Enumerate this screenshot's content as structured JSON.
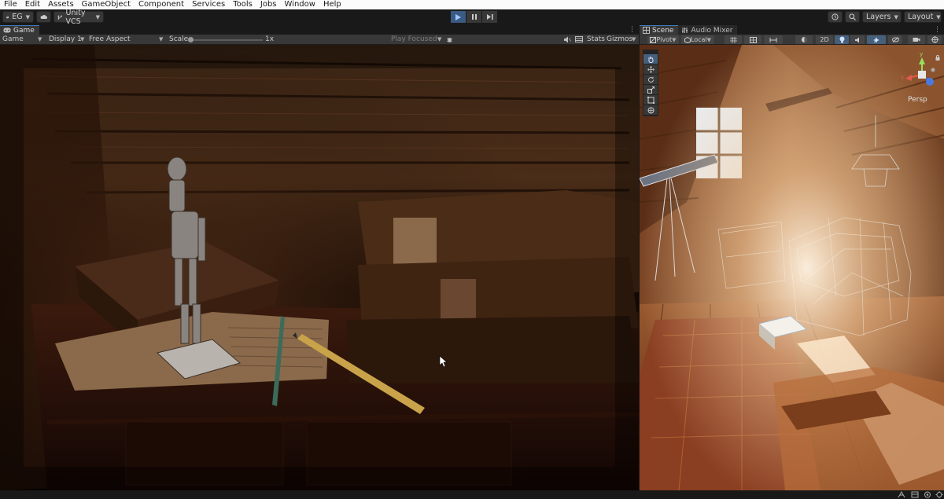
{
  "menu": [
    "File",
    "Edit",
    "Assets",
    "GameObject",
    "Component",
    "Services",
    "Tools",
    "Jobs",
    "Window",
    "Help"
  ],
  "toolbar": {
    "account": "EG",
    "vcs": "Unity VCS",
    "layers": "Layers",
    "layout": "Layout"
  },
  "game": {
    "tab": "Game",
    "view_mode": "Game",
    "display": "Display 1",
    "aspect": "Free Aspect",
    "scale_label": "Scale",
    "scale_value": "1x",
    "scale_fraction": 0.0,
    "play_focused": "Play Focused",
    "stats": "Stats",
    "gizmos": "Gizmos"
  },
  "scene": {
    "tab": "Scene",
    "tab2": "Audio Mixer",
    "pivot": "Pivot",
    "local": "Local",
    "mode_2d": "2D",
    "persp": "Persp",
    "axis_x": "x",
    "axis_y": "y"
  },
  "icons": [
    "cloud-icon",
    "play-icon",
    "pause-icon",
    "step-icon",
    "history-icon",
    "search-icon",
    "hand-tool-icon",
    "move-tool-icon",
    "rotate-tool-icon",
    "scale-tool-icon",
    "rect-tool-icon",
    "transform-tool-icon",
    "gizmo-icon"
  ],
  "colors": {
    "accent": "#3a79bb",
    "play_active": "#3a5b84"
  }
}
